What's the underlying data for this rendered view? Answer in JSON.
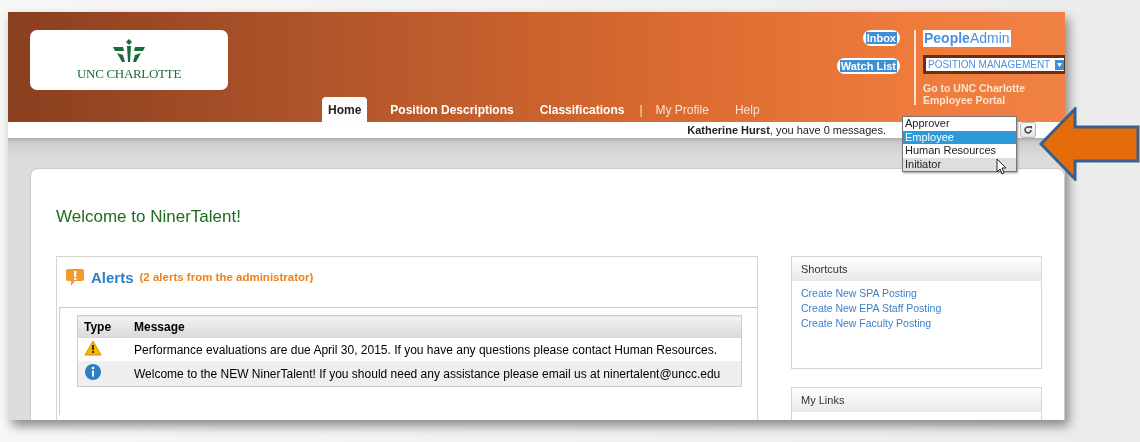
{
  "logo": {
    "text": "UNC CHARLOTTE"
  },
  "header_links": [
    "Inbox",
    "Watch List"
  ],
  "brand": "**People**Admin",
  "module_select": {
    "value": "POSITION MANAGEMENT"
  },
  "portal_link": "Go to UNC Charlotte Employee Portal",
  "nav": {
    "separator": "|",
    "tabs": [
      {
        "label": "Home",
        "selected": true,
        "kind": "primary"
      },
      {
        "label": "Position Descriptions",
        "selected": false,
        "kind": "primary"
      },
      {
        "label": "Classifications",
        "selected": false,
        "kind": "primary"
      },
      {
        "label": "My Profile",
        "selected": false,
        "kind": "secondary"
      },
      {
        "label": "Help",
        "selected": false,
        "kind": "secondary"
      }
    ]
  },
  "message_bar": {
    "text": "**Katherine Hurst**, you have 0 messages."
  },
  "role_dropdown": {
    "options": [
      {
        "label": "Approver",
        "selected": false,
        "hovered": false
      },
      {
        "label": "Employee",
        "selected": true,
        "hovered": false
      },
      {
        "label": "Human Resources",
        "selected": false,
        "hovered": false
      },
      {
        "label": "Initiator",
        "selected": false,
        "hovered": true
      }
    ]
  },
  "welcome": "Welcome to NinerTalent!",
  "alerts": {
    "title": "Alerts",
    "subtitle": "(2 alerts from the administrator)",
    "columns": [
      "Type",
      "Message"
    ],
    "rows": [
      {
        "kind": "warning",
        "message": "Performance evaluations are due April 30, 2015. If you have any questions please contact Human Resources."
      },
      {
        "kind": "info",
        "message": "Welcome to the NEW NinerTalent! If you should need any assistance please email us at ninertalent@uncc.edu"
      }
    ]
  },
  "shortcuts": {
    "title": "Shortcuts",
    "links": [
      "Create New SPA Posting",
      "Create New EPA Staff Posting",
      "Create New Faculty Posting"
    ]
  },
  "my_links": {
    "title": "My Links"
  }
}
